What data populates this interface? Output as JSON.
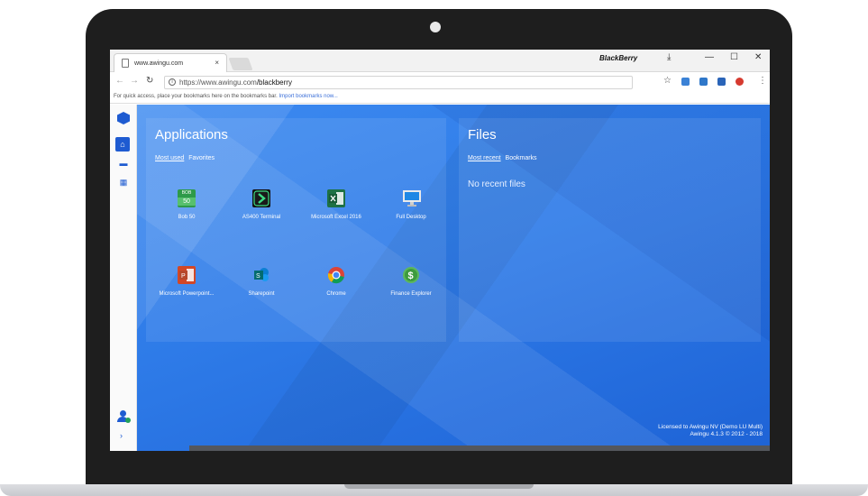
{
  "browser": {
    "tab_title": "www.awingu.com",
    "tab_close": "×",
    "profile": "BlackBerry",
    "url_host": "https://www.awingu.com",
    "url_path": "/blackberry",
    "bookmarks_hint": "For quick access, place your bookmarks here on the bookmarks bar.",
    "import_link": "Import bookmarks now..."
  },
  "applications": {
    "title": "Applications",
    "tab_most_used": "Most used",
    "tab_favorites": "Favorites",
    "items": [
      {
        "name": "Bob 50",
        "icon": "bob50-icon",
        "badge_top": "BOB",
        "badge_bottom": "50"
      },
      {
        "name": "AS400 Terminal",
        "icon": "terminal-icon"
      },
      {
        "name": "Microsoft Excel 2016",
        "icon": "excel-icon"
      },
      {
        "name": "Full Desktop",
        "icon": "desktop-icon"
      },
      {
        "name": "Microsoft Powerpoint...",
        "icon": "powerpoint-icon"
      },
      {
        "name": "Sharepoint",
        "icon": "sharepoint-icon"
      },
      {
        "name": "Chrome",
        "icon": "chrome-icon"
      },
      {
        "name": "Finance Explorer",
        "icon": "finance-icon"
      }
    ]
  },
  "files": {
    "title": "Files",
    "tab_most_recent": "Most recent",
    "tab_bookmarks": "Bookmarks",
    "empty_text": "No recent files"
  },
  "footer": {
    "license": "Licensed to Awingu NV (Demo LU Multi)",
    "version": "Awingu 4.1.3 © 2012 - 2018"
  },
  "colors": {
    "accent": "#1e5bd1",
    "background": "#2e7be8"
  }
}
